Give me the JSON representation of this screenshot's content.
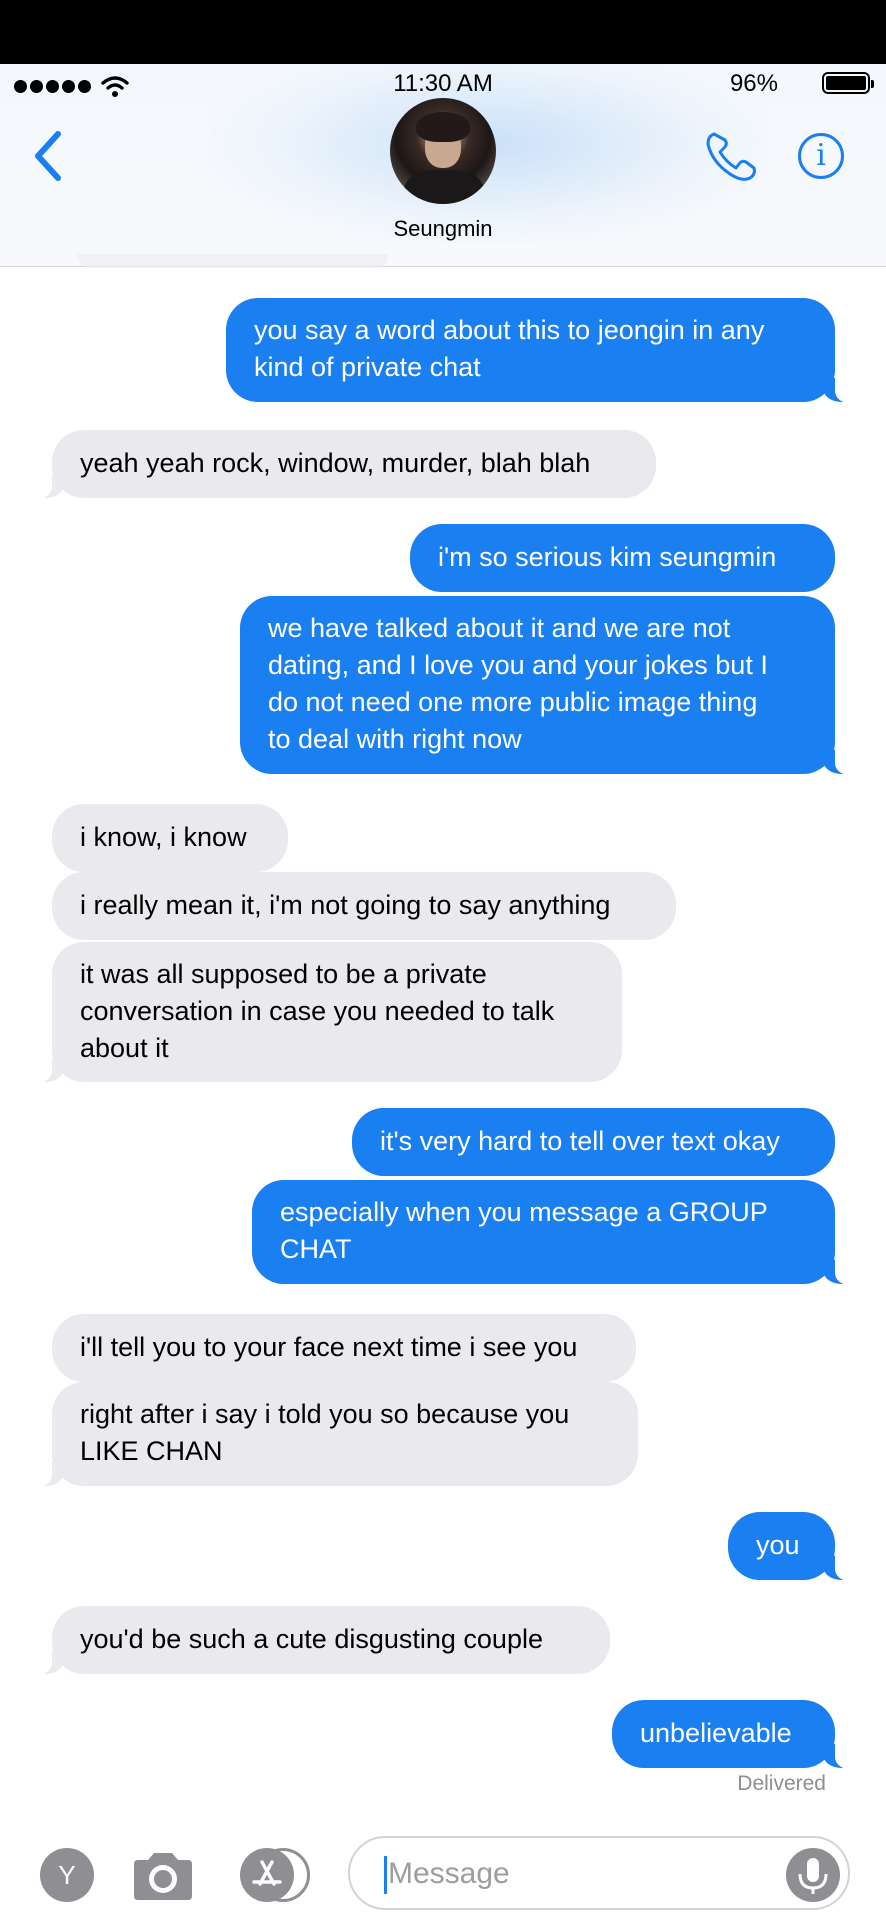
{
  "status_bar": {
    "time": "11:30 AM",
    "battery": "96%"
  },
  "header": {
    "contact_name": "Seungmin"
  },
  "messages": [
    {
      "dir": "sent",
      "text": "you say a word about this to jeongin in any\nkind of private chat"
    },
    {
      "dir": "received",
      "text": "yeah yeah rock, window, murder, blah blah"
    },
    {
      "dir": "sent",
      "text": "i'm so serious kim seungmin"
    },
    {
      "dir": "sent",
      "text": "we have talked about it and we are not\ndating, and I love you and your jokes but I\ndo not need one more public image thing\nto deal with right now"
    },
    {
      "dir": "received",
      "text": "i know, i know"
    },
    {
      "dir": "received",
      "text": "i really mean it, i'm not going to say anything"
    },
    {
      "dir": "received",
      "text": "it was all supposed to be a private\nconversation in case you needed to talk\nabout it"
    },
    {
      "dir": "sent",
      "text": "it's very hard to tell over text okay"
    },
    {
      "dir": "sent",
      "text": "especially when you message a GROUP\nCHAT"
    },
    {
      "dir": "received",
      "text": "i'll tell you to your face next time i see you"
    },
    {
      "dir": "received",
      "text": "right after i say i told you so because you\nLIKE CHAN"
    },
    {
      "dir": "sent",
      "text": "you"
    },
    {
      "dir": "received",
      "text": "you'd be such a cute disgusting couple"
    },
    {
      "dir": "sent",
      "text": "unbelievable"
    }
  ],
  "delivered_label": "Delivered",
  "input": {
    "placeholder": "Message",
    "y_button": "Y"
  },
  "colors": {
    "accent": "#1a7ff0",
    "received_bubble": "#e9e9ee",
    "sent_text": "#ffffff"
  }
}
